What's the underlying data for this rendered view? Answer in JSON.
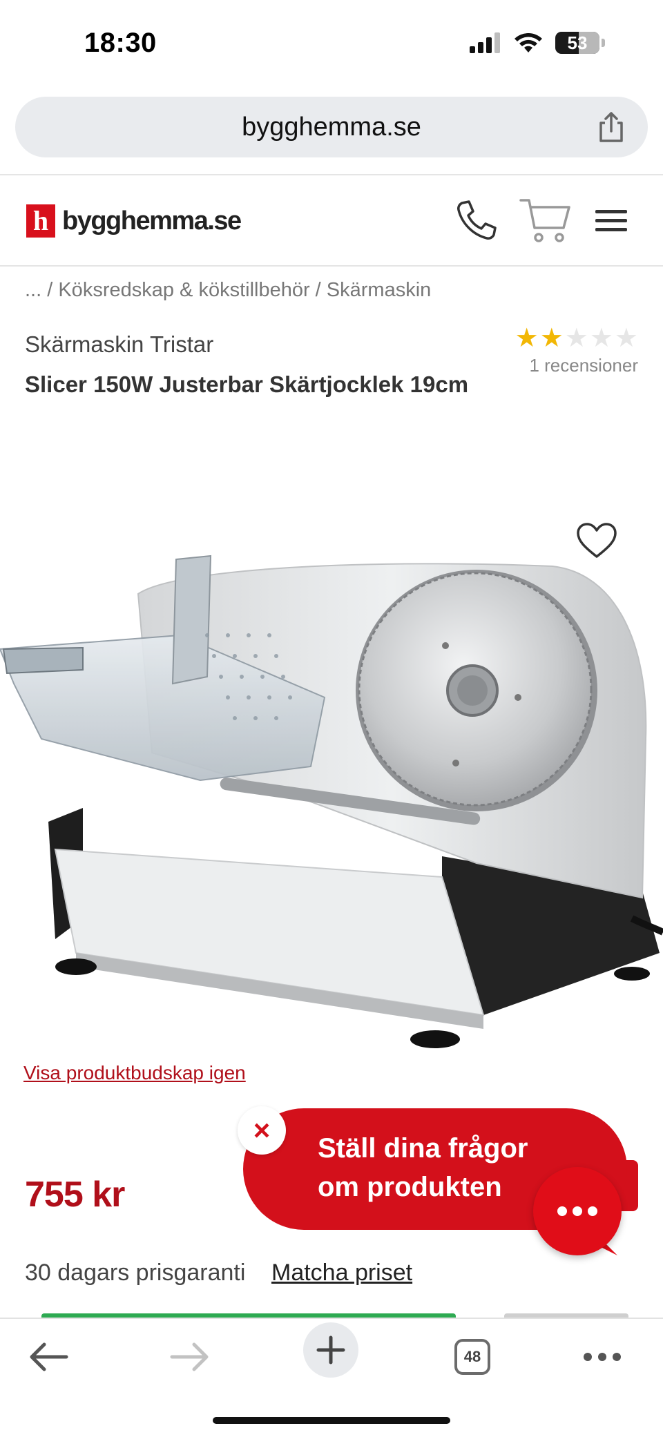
{
  "status_bar": {
    "time": "18:30",
    "battery": "53"
  },
  "browser": {
    "url": "bygghemma.se",
    "tab_count": "48"
  },
  "site": {
    "logo_mark": "h",
    "logo_text": "bygghemma.se"
  },
  "breadcrumb": "... / Köksredskap & kökstillbehör / Skärmaskin",
  "product": {
    "brand_line": "Skärmaskin Tristar",
    "title": "Slicer 150W Justerbar Skärtjocklek 19cm",
    "rating": 2,
    "rating_max": 5,
    "reviews": "1 recensioner",
    "show_message_link": "Visa produktbudskap igen",
    "price": "755 kr",
    "price_guarantee": "30 dagars prisgaranti",
    "match_price": "Matcha priset"
  },
  "chat": {
    "line1": "Ställ dina frågor",
    "line2": "om produkten",
    "close_label": "×"
  },
  "colors": {
    "brand_red": "#d3101b",
    "price_red": "#b00f1a",
    "star": "#f2b705"
  },
  "icons": [
    "share-icon",
    "phone-icon",
    "cart-icon",
    "menu-icon",
    "heart-icon",
    "back-icon",
    "forward-icon",
    "plus-icon",
    "tabs-icon",
    "more-icon"
  ]
}
